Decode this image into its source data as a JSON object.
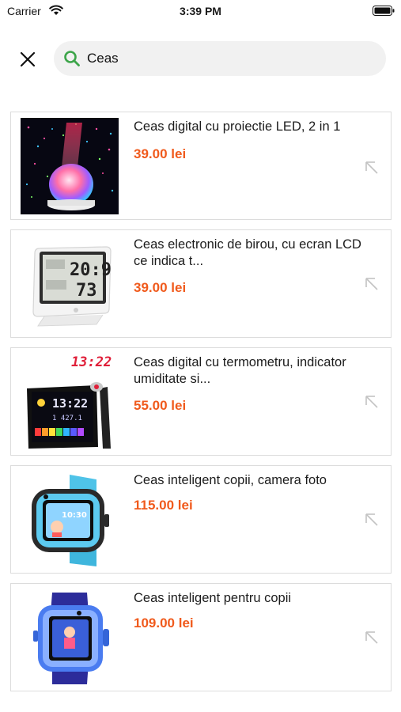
{
  "status_bar": {
    "carrier": "Carrier",
    "time": "3:39 PM"
  },
  "search": {
    "value": "Ceas",
    "accent_color": "#3da54a"
  },
  "theme": {
    "price_color": "#f05a1c",
    "card_border": "#dcdcdc"
  },
  "results": [
    {
      "title": "Ceas digital cu proiectie LED, 2 in 1",
      "price": "39.00 lei"
    },
    {
      "title": "Ceas electronic de birou, cu ecran LCD ce indica t...",
      "price": "39.00 lei"
    },
    {
      "title": "Ceas digital cu termometru, indicator umiditate si...",
      "price": "55.00 lei"
    },
    {
      "title": "Ceas inteligent copii, camera foto",
      "price": "115.00 lei"
    },
    {
      "title": "Ceas inteligent pentru copii",
      "price": "109.00 lei"
    }
  ],
  "thumbs": {
    "lcd_clock": {
      "line1": "20:9",
      "line2": "73"
    },
    "projector_clock": {
      "projection": "13:22",
      "screen": "13:22"
    },
    "kids_watch_1": {
      "screen": "10:30"
    }
  }
}
